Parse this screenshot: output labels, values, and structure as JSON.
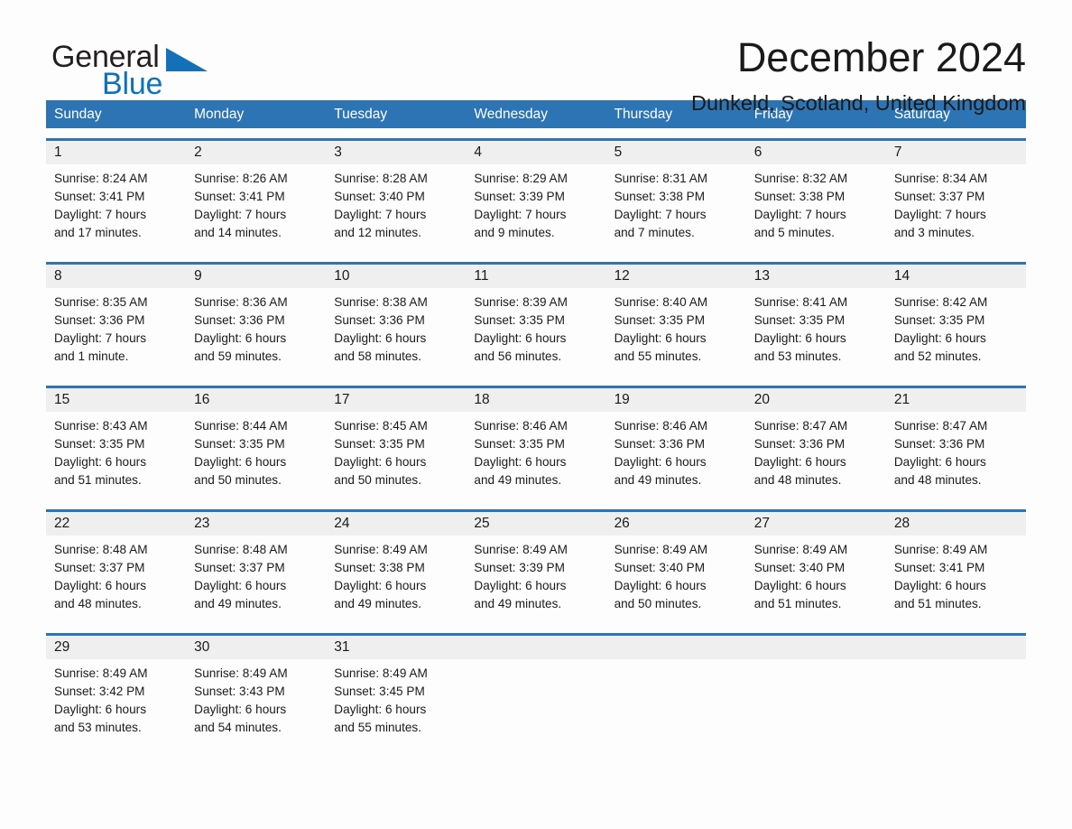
{
  "brand": {
    "word1": "General",
    "word2": "Blue",
    "triangle_color": "#1470b8",
    "word2_color": "#0d72bb"
  },
  "header": {
    "month_title": "December 2024",
    "location": "Dunkeld, Scotland, United Kingdom"
  },
  "calendar": {
    "header_bg": "#2d74b5",
    "daynum_bg": "#efefef",
    "weekdays": [
      "Sunday",
      "Monday",
      "Tuesday",
      "Wednesday",
      "Thursday",
      "Friday",
      "Saturday"
    ],
    "weeks": [
      {
        "days": [
          {
            "num": "1",
            "sunrise": "Sunrise: 8:24 AM",
            "sunset": "Sunset: 3:41 PM",
            "daylight1": "Daylight: 7 hours",
            "daylight2": "and 17 minutes."
          },
          {
            "num": "2",
            "sunrise": "Sunrise: 8:26 AM",
            "sunset": "Sunset: 3:41 PM",
            "daylight1": "Daylight: 7 hours",
            "daylight2": "and 14 minutes."
          },
          {
            "num": "3",
            "sunrise": "Sunrise: 8:28 AM",
            "sunset": "Sunset: 3:40 PM",
            "daylight1": "Daylight: 7 hours",
            "daylight2": "and 12 minutes."
          },
          {
            "num": "4",
            "sunrise": "Sunrise: 8:29 AM",
            "sunset": "Sunset: 3:39 PM",
            "daylight1": "Daylight: 7 hours",
            "daylight2": "and 9 minutes."
          },
          {
            "num": "5",
            "sunrise": "Sunrise: 8:31 AM",
            "sunset": "Sunset: 3:38 PM",
            "daylight1": "Daylight: 7 hours",
            "daylight2": "and 7 minutes."
          },
          {
            "num": "6",
            "sunrise": "Sunrise: 8:32 AM",
            "sunset": "Sunset: 3:38 PM",
            "daylight1": "Daylight: 7 hours",
            "daylight2": "and 5 minutes."
          },
          {
            "num": "7",
            "sunrise": "Sunrise: 8:34 AM",
            "sunset": "Sunset: 3:37 PM",
            "daylight1": "Daylight: 7 hours",
            "daylight2": "and 3 minutes."
          }
        ]
      },
      {
        "days": [
          {
            "num": "8",
            "sunrise": "Sunrise: 8:35 AM",
            "sunset": "Sunset: 3:36 PM",
            "daylight1": "Daylight: 7 hours",
            "daylight2": "and 1 minute."
          },
          {
            "num": "9",
            "sunrise": "Sunrise: 8:36 AM",
            "sunset": "Sunset: 3:36 PM",
            "daylight1": "Daylight: 6 hours",
            "daylight2": "and 59 minutes."
          },
          {
            "num": "10",
            "sunrise": "Sunrise: 8:38 AM",
            "sunset": "Sunset: 3:36 PM",
            "daylight1": "Daylight: 6 hours",
            "daylight2": "and 58 minutes."
          },
          {
            "num": "11",
            "sunrise": "Sunrise: 8:39 AM",
            "sunset": "Sunset: 3:35 PM",
            "daylight1": "Daylight: 6 hours",
            "daylight2": "and 56 minutes."
          },
          {
            "num": "12",
            "sunrise": "Sunrise: 8:40 AM",
            "sunset": "Sunset: 3:35 PM",
            "daylight1": "Daylight: 6 hours",
            "daylight2": "and 55 minutes."
          },
          {
            "num": "13",
            "sunrise": "Sunrise: 8:41 AM",
            "sunset": "Sunset: 3:35 PM",
            "daylight1": "Daylight: 6 hours",
            "daylight2": "and 53 minutes."
          },
          {
            "num": "14",
            "sunrise": "Sunrise: 8:42 AM",
            "sunset": "Sunset: 3:35 PM",
            "daylight1": "Daylight: 6 hours",
            "daylight2": "and 52 minutes."
          }
        ]
      },
      {
        "days": [
          {
            "num": "15",
            "sunrise": "Sunrise: 8:43 AM",
            "sunset": "Sunset: 3:35 PM",
            "daylight1": "Daylight: 6 hours",
            "daylight2": "and 51 minutes."
          },
          {
            "num": "16",
            "sunrise": "Sunrise: 8:44 AM",
            "sunset": "Sunset: 3:35 PM",
            "daylight1": "Daylight: 6 hours",
            "daylight2": "and 50 minutes."
          },
          {
            "num": "17",
            "sunrise": "Sunrise: 8:45 AM",
            "sunset": "Sunset: 3:35 PM",
            "daylight1": "Daylight: 6 hours",
            "daylight2": "and 50 minutes."
          },
          {
            "num": "18",
            "sunrise": "Sunrise: 8:46 AM",
            "sunset": "Sunset: 3:35 PM",
            "daylight1": "Daylight: 6 hours",
            "daylight2": "and 49 minutes."
          },
          {
            "num": "19",
            "sunrise": "Sunrise: 8:46 AM",
            "sunset": "Sunset: 3:36 PM",
            "daylight1": "Daylight: 6 hours",
            "daylight2": "and 49 minutes."
          },
          {
            "num": "20",
            "sunrise": "Sunrise: 8:47 AM",
            "sunset": "Sunset: 3:36 PM",
            "daylight1": "Daylight: 6 hours",
            "daylight2": "and 48 minutes."
          },
          {
            "num": "21",
            "sunrise": "Sunrise: 8:47 AM",
            "sunset": "Sunset: 3:36 PM",
            "daylight1": "Daylight: 6 hours",
            "daylight2": "and 48 minutes."
          }
        ]
      },
      {
        "days": [
          {
            "num": "22",
            "sunrise": "Sunrise: 8:48 AM",
            "sunset": "Sunset: 3:37 PM",
            "daylight1": "Daylight: 6 hours",
            "daylight2": "and 48 minutes."
          },
          {
            "num": "23",
            "sunrise": "Sunrise: 8:48 AM",
            "sunset": "Sunset: 3:37 PM",
            "daylight1": "Daylight: 6 hours",
            "daylight2": "and 49 minutes."
          },
          {
            "num": "24",
            "sunrise": "Sunrise: 8:49 AM",
            "sunset": "Sunset: 3:38 PM",
            "daylight1": "Daylight: 6 hours",
            "daylight2": "and 49 minutes."
          },
          {
            "num": "25",
            "sunrise": "Sunrise: 8:49 AM",
            "sunset": "Sunset: 3:39 PM",
            "daylight1": "Daylight: 6 hours",
            "daylight2": "and 49 minutes."
          },
          {
            "num": "26",
            "sunrise": "Sunrise: 8:49 AM",
            "sunset": "Sunset: 3:40 PM",
            "daylight1": "Daylight: 6 hours",
            "daylight2": "and 50 minutes."
          },
          {
            "num": "27",
            "sunrise": "Sunrise: 8:49 AM",
            "sunset": "Sunset: 3:40 PM",
            "daylight1": "Daylight: 6 hours",
            "daylight2": "and 51 minutes."
          },
          {
            "num": "28",
            "sunrise": "Sunrise: 8:49 AM",
            "sunset": "Sunset: 3:41 PM",
            "daylight1": "Daylight: 6 hours",
            "daylight2": "and 51 minutes."
          }
        ]
      },
      {
        "days": [
          {
            "num": "29",
            "sunrise": "Sunrise: 8:49 AM",
            "sunset": "Sunset: 3:42 PM",
            "daylight1": "Daylight: 6 hours",
            "daylight2": "and 53 minutes."
          },
          {
            "num": "30",
            "sunrise": "Sunrise: 8:49 AM",
            "sunset": "Sunset: 3:43 PM",
            "daylight1": "Daylight: 6 hours",
            "daylight2": "and 54 minutes."
          },
          {
            "num": "31",
            "sunrise": "Sunrise: 8:49 AM",
            "sunset": "Sunset: 3:45 PM",
            "daylight1": "Daylight: 6 hours",
            "daylight2": "and 55 minutes."
          },
          {
            "num": "",
            "sunrise": "",
            "sunset": "",
            "daylight1": "",
            "daylight2": ""
          },
          {
            "num": "",
            "sunrise": "",
            "sunset": "",
            "daylight1": "",
            "daylight2": ""
          },
          {
            "num": "",
            "sunrise": "",
            "sunset": "",
            "daylight1": "",
            "daylight2": ""
          },
          {
            "num": "",
            "sunrise": "",
            "sunset": "",
            "daylight1": "",
            "daylight2": ""
          }
        ]
      }
    ]
  }
}
